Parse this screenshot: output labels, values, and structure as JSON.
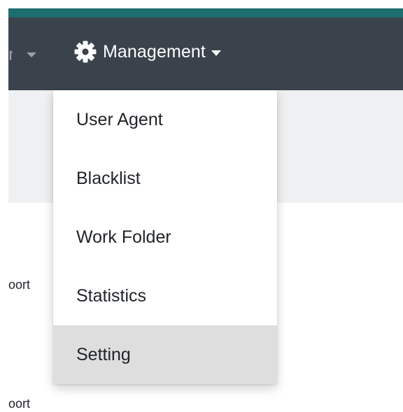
{
  "navbar": {
    "previous_item_label": "n",
    "management": {
      "icon": "gear-icon",
      "label": "Management"
    }
  },
  "dropdown": {
    "items": [
      {
        "label": "User Agent"
      },
      {
        "label": "Blacklist"
      },
      {
        "label": "Work Folder"
      },
      {
        "label": "Statistics"
      },
      {
        "label": "Setting",
        "highlighted": true
      }
    ]
  },
  "content": {
    "rows": [
      {
        "text": "oort"
      },
      {
        "text": "oort"
      }
    ]
  },
  "colors": {
    "navbar_bg": "#3a434b",
    "accent_strip": "#1d6f6f",
    "subheader_bg": "#eef0f2",
    "hover_bg": "#dedede"
  }
}
